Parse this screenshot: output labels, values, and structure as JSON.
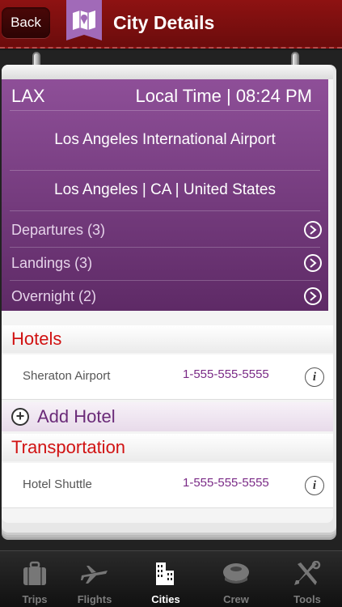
{
  "header": {
    "back_label": "Back",
    "title": "City Details",
    "badge_icon": "map-icon"
  },
  "airport": {
    "code": "LAX",
    "local_time": "Local Time | 08:24 PM",
    "name": "Los Angeles International Airport",
    "location": "Los Angeles | CA | United States"
  },
  "nav_rows": [
    {
      "label": "Departures (3)",
      "icon": "chevron-right-icon"
    },
    {
      "label": "Landings (3)",
      "icon": "chevron-right-icon"
    },
    {
      "label": "Overnight (2)",
      "icon": "chevron-right-icon"
    }
  ],
  "hotels": {
    "heading": "Hotels",
    "items": [
      {
        "name": "Sheraton Airport",
        "phone": "1-555-555-5555",
        "icon": "info-icon"
      }
    ],
    "add_label": "Add Hotel"
  },
  "transportation": {
    "heading": "Transportation",
    "items": [
      {
        "name": "Hotel Shuttle",
        "phone": "1-555-555-5555",
        "icon": "info-icon"
      }
    ]
  },
  "tabbar": {
    "items": [
      {
        "label": "Trips",
        "icon": "suitcase-icon",
        "active": false
      },
      {
        "label": "Flights",
        "icon": "airplane-icon",
        "active": false
      },
      {
        "label": "Cities",
        "icon": "buildings-icon",
        "active": true
      },
      {
        "label": "Crew",
        "icon": "pilot-cap-icon",
        "active": false
      },
      {
        "label": "Tools",
        "icon": "tools-icon",
        "active": false
      }
    ]
  },
  "colors": {
    "header_red": "#8e1212",
    "panel_purple": "#8e4f98",
    "section_red": "#d11212",
    "phone_purple": "#7a2a86"
  }
}
